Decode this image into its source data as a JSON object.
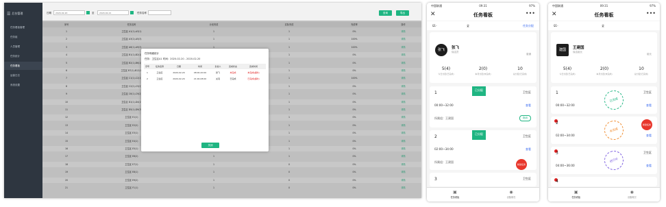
{
  "desktop": {
    "logo_label": "后台管理",
    "menu": [
      {
        "label": "任务看板管理"
      },
      {
        "label": "任务组"
      },
      {
        "label": "人员管理"
      },
      {
        "label": "任务统计"
      },
      {
        "label": "任务看板"
      },
      {
        "label": "运营日志"
      },
      {
        "label": "系统设置"
      }
    ],
    "filter": {
      "date_label": "日期",
      "date_value": "2020-02-20",
      "sep": "至",
      "date_value2": "2020-02-21",
      "name_label": "任务名称",
      "name_placeholder": ""
    },
    "buttons": {
      "search": "查询",
      "export": "导出"
    },
    "table": {
      "headers": [
        "序号",
        "任务名称",
        "计划完成",
        "实际完成",
        "完成率",
        "操作"
      ],
      "rows": [
        [
          "1",
          "卫生区 A1(1)-A3(1)",
          "1",
          "1",
          "0%",
          "详情"
        ],
        [
          "2",
          "卫生区 A3(2)-A5(3)",
          "1",
          "1",
          "100%",
          "详情"
        ],
        [
          "3",
          "卫生区 A6(1)-A9(3)",
          "1",
          "1",
          "100%",
          "详情"
        ],
        [
          "4",
          "卫生区 B1(1)-B2(1)",
          "1",
          "1",
          "0%",
          "详情"
        ],
        [
          "5",
          "卫生区 B2(1)-B6(1)",
          "1",
          "1",
          "0%",
          "详情"
        ],
        [
          "6",
          "卫生区 B7(1)-B12(1)",
          "1",
          "1",
          "0%",
          "详情"
        ],
        [
          "7",
          "卫生区 C1(1)-C2(1)",
          "1",
          "1",
          "100%",
          "详情"
        ],
        [
          "8",
          "卫生区 C2(2)-C5(2)",
          "1",
          "1",
          "0%",
          "详情"
        ],
        [
          "9",
          "卫生区 C6(1)-C9(2)",
          "1",
          "1",
          "0%",
          "详情"
        ],
        [
          "10",
          "卫生区 D1(1)-D4(2)",
          "1",
          "1",
          "0%",
          "详情"
        ],
        [
          "11",
          "卫生区 D5(1)-D9(3)",
          "1",
          "1",
          "0%",
          "详情"
        ],
        [
          "12",
          "卫生区 E1(1)",
          "1",
          "1",
          "0%",
          "详情"
        ],
        [
          "13",
          "卫生区 E2(2)",
          "1",
          "1",
          "0%",
          "详情"
        ],
        [
          "14",
          "卫生区 E3(1)",
          "1",
          "1",
          "0%",
          "详情"
        ],
        [
          "15",
          "卫生区 E4(1)",
          "1",
          "1",
          "0%",
          "详情"
        ],
        [
          "16",
          "卫生区 E5(1)",
          "1",
          "1",
          "0%",
          "详情"
        ],
        [
          "17",
          "卫生区 E6(2)",
          "1",
          "1",
          "0%",
          "详情"
        ],
        [
          "18",
          "卫生区 E7(1)",
          "1",
          "0",
          "0%",
          "详情"
        ],
        [
          "19",
          "卫生区 E8(1)",
          "1",
          "0",
          "0%",
          "详情"
        ],
        [
          "20",
          "卫生区 E9(2)",
          "1",
          "0",
          "0%",
          "详情"
        ],
        [
          "21",
          "卫生区 F1(1)",
          "1",
          "0",
          "0%",
          "详情"
        ]
      ]
    },
    "modal": {
      "title": "任务明细统计",
      "info": "任务：卫生区A1    时间：2020-02-20 - 2020-02-20",
      "headers": [
        "序号",
        "任务名称",
        "日期",
        "时间",
        "负责人",
        "完成状态",
        "完成时间"
      ],
      "rows": [
        [
          "1",
          "卫生区",
          "2020-02-20",
          "08:00-20:00",
          "张飞",
          "未完成",
          "未完成(超时)"
        ],
        [
          "2",
          "卫生区",
          "2020-02-20",
          "21:00-08:00",
          "关羽",
          "已完成",
          "已完成(超时)"
        ]
      ],
      "close_label": "关闭"
    }
  },
  "phone1": {
    "status": {
      "carrier": "中国联通",
      "time": "09:31",
      "battery": "97%"
    },
    "title": "任务看板",
    "filter": {
      "group": "01-03",
      "status": "全部状态",
      "action": "任务分配"
    },
    "profile": {
      "avatar": "张飞",
      "name": "张飞",
      "role": "保洁员",
      "side": "普通"
    },
    "stats": [
      {
        "n": "5(4)",
        "l": "今日分配(已完成)"
      },
      {
        "n": "2(0)",
        "l": "本月分配(未完成)"
      },
      {
        "n": "10",
        "l": "总分配(已完成)"
      }
    ],
    "tasks": [
      {
        "num": "1",
        "area": "卫生区",
        "time": "00:00~32:00",
        "link": "查看",
        "group": "所属组：王建国",
        "handle": "指派",
        "tag": "已分配"
      },
      {
        "num": "2",
        "area": "卫生区",
        "time": "02:00~34:00",
        "link": "查看",
        "group": "所属组：王建国",
        "handle": "",
        "tag": "已分配"
      },
      {
        "num": "3",
        "area": "卫生区",
        "time": "",
        "link": "",
        "group": "",
        "handle": "",
        "tag": ""
      }
    ],
    "fab": "新建任务",
    "tabs": [
      {
        "label": "任务看板"
      },
      {
        "label": "设备概况"
      }
    ]
  },
  "phone2": {
    "status": {
      "carrier": "中国联通",
      "time": "09:31",
      "battery": "97%"
    },
    "title": "任务看板",
    "filter": {
      "group": "01-03",
      "status": "全部状态"
    },
    "profile": {
      "avatar": "建国",
      "name": "王建国",
      "role": "保洁组长",
      "side": "组长"
    },
    "stats": [
      {
        "n": "5(4)",
        "l": "今日分配(已完成)"
      },
      {
        "n": "2(0)",
        "l": "本月分配(未完成)"
      },
      {
        "n": "10",
        "l": "总分配(已完成)"
      }
    ],
    "tasks": [
      {
        "num": "1",
        "area": "卫生区",
        "time": "00:00~32:00",
        "link": "查看",
        "stamp": "已完成"
      },
      {
        "num": "2",
        "area": "卫生区",
        "time": "02:00~34:00",
        "link": "查看",
        "stamp": "未完成"
      },
      {
        "num": "3",
        "area": "卫生区",
        "time": "04:00~36:00",
        "link": "查看",
        "stamp": "进行中"
      },
      {
        "num": "4",
        "area": "卫生区",
        "time": "",
        "link": "",
        "stamp": ""
      }
    ],
    "fab": "新建任务",
    "tabs": [
      {
        "label": "任务看板"
      },
      {
        "label": "设备概况"
      }
    ]
  },
  "colors": {
    "accent": "#1fb582",
    "sidebar": "#2e3640",
    "link": "#3e6df0",
    "alert": "#e02020"
  }
}
